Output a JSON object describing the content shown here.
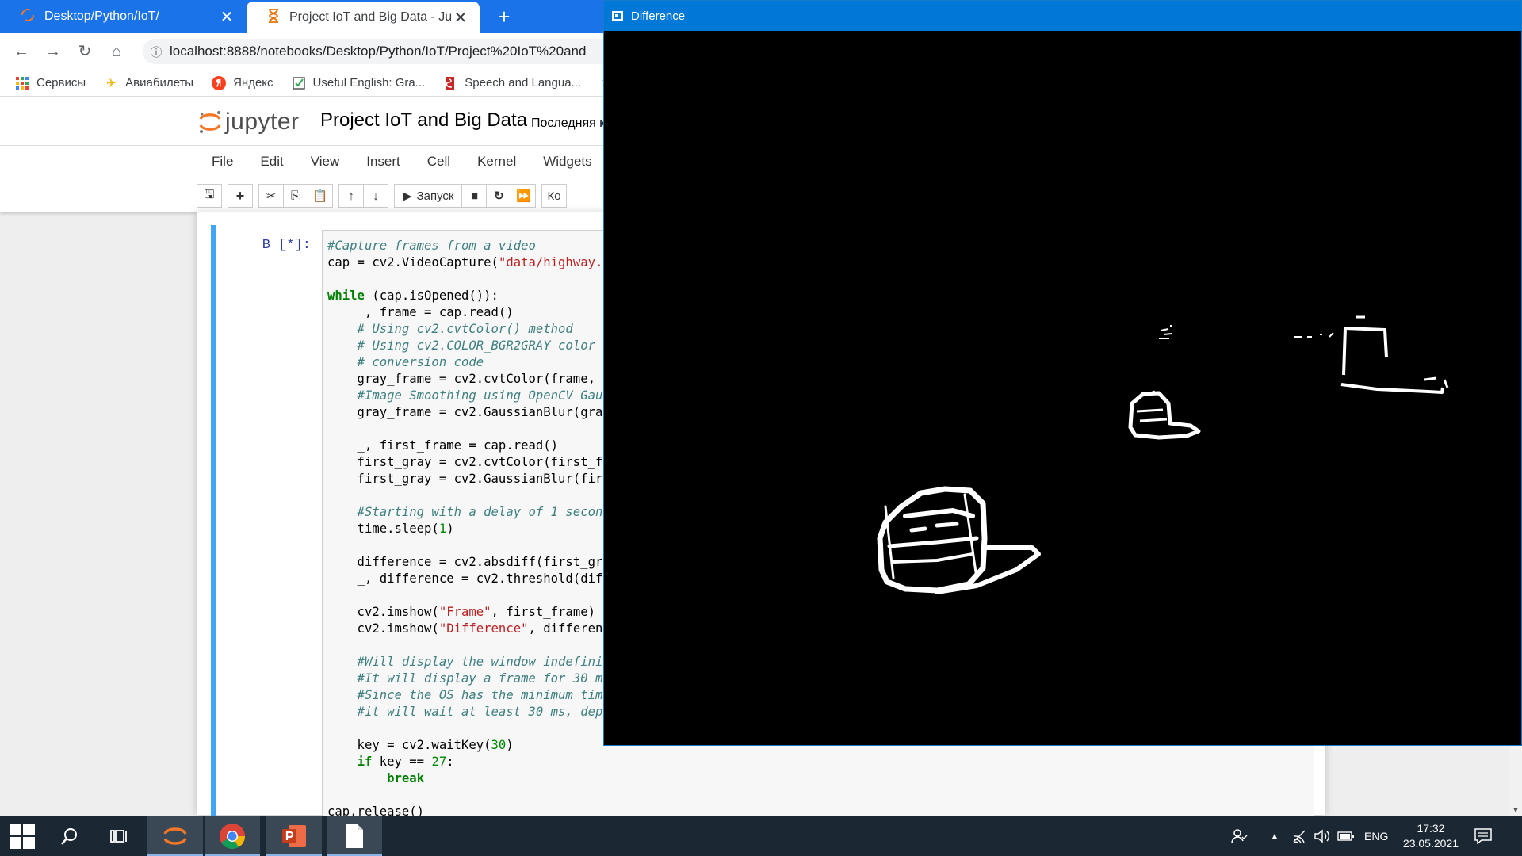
{
  "browser": {
    "tabs": [
      {
        "title": "Desktop/Python/IoT/",
        "close": "✕"
      },
      {
        "title": "Project IoT and Big Data - Jupyte",
        "close": "✕"
      }
    ],
    "new_tab": "+",
    "url": "localhost:8888/notebooks/Desktop/Python/IoT/Project%20IoT%20and",
    "bookmarks": [
      {
        "label": "Сервисы",
        "icon": "apps-grid-icon"
      },
      {
        "label": "Авиабилеты",
        "icon": "plane-icon"
      },
      {
        "label": "Яндекс",
        "icon": "yandex-icon"
      },
      {
        "label": "Useful English: Gra...",
        "icon": "checkbox-icon"
      },
      {
        "label": "Speech and Langua...",
        "icon": "ticket-icon"
      }
    ]
  },
  "jupyter": {
    "logo_text": "jupyter",
    "notebook_title": "Project IoT and Big Data",
    "checkpoint": "Последняя к",
    "menu": [
      "File",
      "Edit",
      "View",
      "Insert",
      "Cell",
      "Kernel",
      "Widgets"
    ],
    "toolbar": {
      "run_label": "Запуск",
      "cell_type": "Ко"
    },
    "cell": {
      "prompt": "В [*]:",
      "code_lines": [
        [
          {
            "t": "#Capture frames from a video",
            "c": "comment"
          }
        ],
        [
          {
            "t": "cap = cv2.VideoCapture(",
            "c": ""
          },
          {
            "t": "\"data/highway.",
            "c": "string"
          }
        ],
        [],
        [
          {
            "t": "while",
            "c": "keyword"
          },
          {
            "t": " (cap.isOpened()):",
            "c": ""
          }
        ],
        [
          {
            "t": "    _, frame = cap.read()",
            "c": ""
          }
        ],
        [
          {
            "t": "    # Using cv2.cvtColor() method",
            "c": "comment"
          }
        ],
        [
          {
            "t": "    # Using cv2.COLOR_BGR2GRAY color",
            "c": "comment"
          }
        ],
        [
          {
            "t": "    # conversion code",
            "c": "comment"
          }
        ],
        [
          {
            "t": "    gray_frame = cv2.cvtColor(frame,",
            "c": ""
          }
        ],
        [
          {
            "t": "    #Image Smoothing using OpenCV Gau",
            "c": "comment"
          }
        ],
        [
          {
            "t": "    gray_frame = cv2.GaussianBlur(gra",
            "c": ""
          }
        ],
        [],
        [
          {
            "t": "    _, first_frame = cap.read()",
            "c": ""
          }
        ],
        [
          {
            "t": "    first_gray = cv2.cvtColor(first_f",
            "c": ""
          }
        ],
        [
          {
            "t": "    first_gray = cv2.GaussianBlur(fir",
            "c": ""
          }
        ],
        [],
        [
          {
            "t": "    #Starting with a delay of 1 secon",
            "c": "comment"
          }
        ],
        [
          {
            "t": "    time.sleep(",
            "c": ""
          },
          {
            "t": "1",
            "c": "number"
          },
          {
            "t": ")",
            "c": ""
          }
        ],
        [],
        [
          {
            "t": "    difference = cv2.absdiff(first_gr",
            "c": ""
          }
        ],
        [
          {
            "t": "    _, difference = cv2.threshold(dif",
            "c": ""
          }
        ],
        [],
        [
          {
            "t": "    cv2.imshow(",
            "c": ""
          },
          {
            "t": "\"Frame\"",
            "c": "string"
          },
          {
            "t": ", first_frame)",
            "c": ""
          }
        ],
        [
          {
            "t": "    cv2.imshow(",
            "c": ""
          },
          {
            "t": "\"Difference\"",
            "c": "string"
          },
          {
            "t": ", differen",
            "c": ""
          }
        ],
        [],
        [
          {
            "t": "    #Will display the window indefini",
            "c": "comment"
          }
        ],
        [
          {
            "t": "    #It will display a frame for 30 m",
            "c": "comment"
          }
        ],
        [
          {
            "t": "    #Since the OS has the minimum tim",
            "c": "comment"
          }
        ],
        [
          {
            "t": "    #it will wait at least 30 ms, dep",
            "c": "comment"
          }
        ],
        [],
        [
          {
            "t": "    key = cv2.waitKey(",
            "c": ""
          },
          {
            "t": "30",
            "c": "number"
          },
          {
            "t": ")",
            "c": ""
          }
        ],
        [
          {
            "t": "    ",
            "c": ""
          },
          {
            "t": "if",
            "c": "keyword"
          },
          {
            "t": " key == ",
            "c": ""
          },
          {
            "t": "27",
            "c": "number"
          },
          {
            "t": ":",
            "c": ""
          }
        ],
        [
          {
            "t": "        ",
            "c": ""
          },
          {
            "t": "break",
            "c": "keyword"
          }
        ],
        [],
        [
          {
            "t": "cap.release()",
            "c": ""
          }
        ]
      ]
    }
  },
  "cv_window": {
    "title": "Difference"
  },
  "taskbar": {
    "language": "ENG",
    "time": "17:32",
    "date": "23.05.2021"
  },
  "colors": {
    "chrome_blue": "#1a73e8",
    "cell_selected": "#42a5f5",
    "win_titlebar": "#0078d7",
    "taskbar": "#1b2733"
  }
}
